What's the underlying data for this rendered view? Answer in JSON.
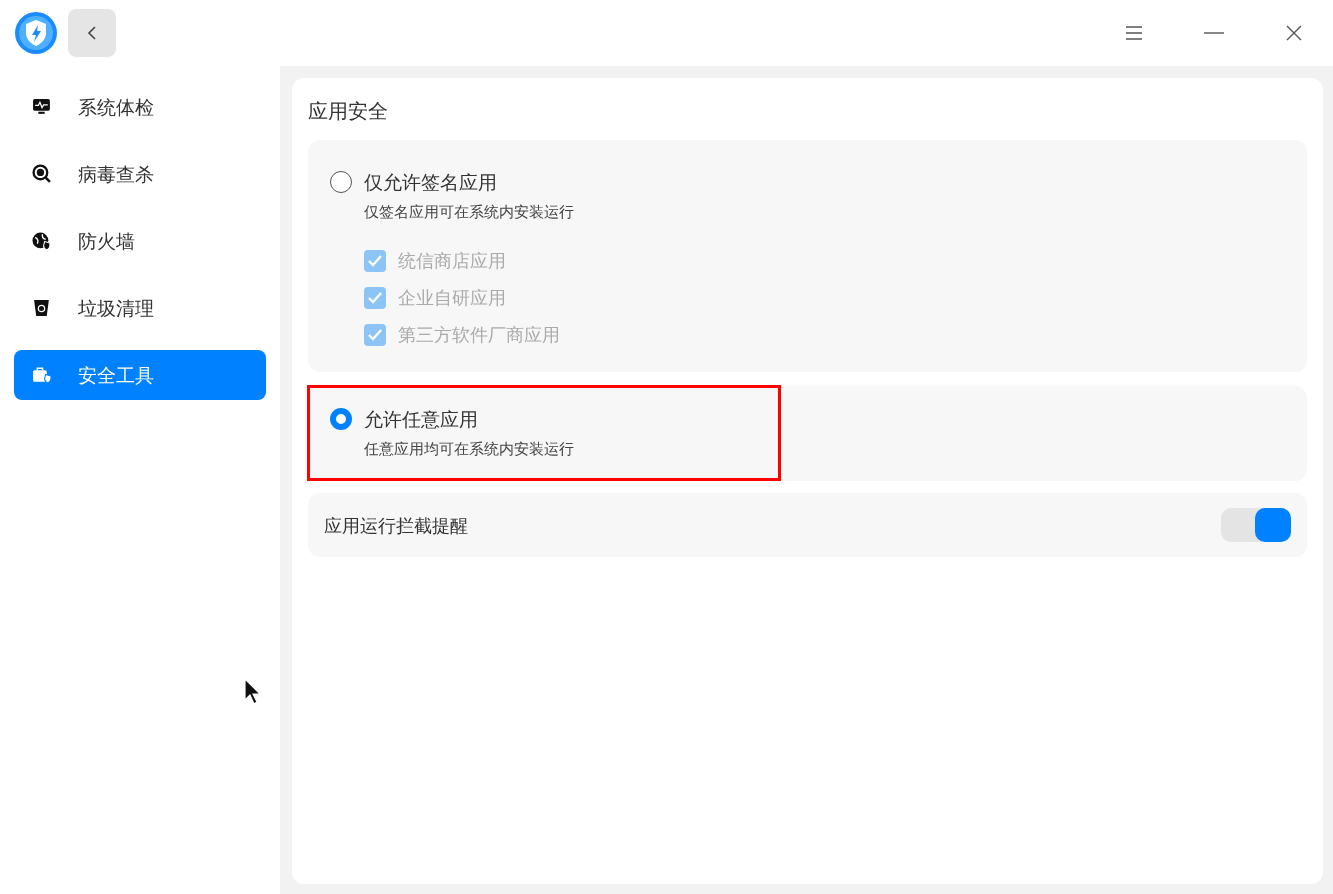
{
  "sidebar": {
    "items": [
      {
        "label": "系统体检",
        "selected": false
      },
      {
        "label": "病毒查杀",
        "selected": false
      },
      {
        "label": "防火墙",
        "selected": false
      },
      {
        "label": "垃圾清理",
        "selected": false
      },
      {
        "label": "安全工具",
        "selected": true
      }
    ]
  },
  "section": {
    "title": "应用安全",
    "options": [
      {
        "label": "仅允许签名应用",
        "description": "仅签名应用可在系统内安装运行",
        "selected": false,
        "highlighted": false,
        "checkboxes": [
          {
            "label": "统信商店应用",
            "checked": true,
            "disabled": true
          },
          {
            "label": "企业自研应用",
            "checked": true,
            "disabled": true
          },
          {
            "label": "第三方软件厂商应用",
            "checked": true,
            "disabled": true
          }
        ]
      },
      {
        "label": "允许任意应用",
        "description": "任意应用均可在系统内安装运行",
        "selected": true,
        "highlighted": true
      }
    ],
    "toggle": {
      "label": "应用运行拦截提醒",
      "on": true
    }
  }
}
